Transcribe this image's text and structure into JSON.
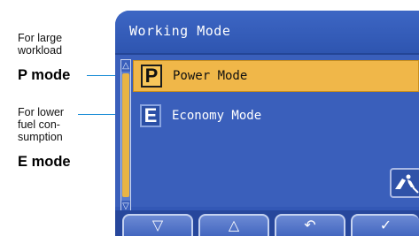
{
  "annotations": {
    "p_desc_line1": "For large",
    "p_desc_line2": "workload",
    "p_mode": "P mode",
    "e_desc_line1": "For lower",
    "e_desc_line2": "fuel con-",
    "e_desc_line3": "sumption",
    "e_mode": "E mode"
  },
  "screen": {
    "title": "Working Mode",
    "items": [
      {
        "letter": "P",
        "label": "Power Mode",
        "selected": true
      },
      {
        "letter": "E",
        "label": "Economy Mode",
        "selected": false
      }
    ],
    "scroll_up_glyph": "△",
    "scroll_down_glyph": "▽"
  },
  "softkeys": [
    {
      "glyph": "▽",
      "icon": "down-arrow-icon"
    },
    {
      "glyph": "△",
      "icon": "up-arrow-icon"
    },
    {
      "glyph": "↶",
      "icon": "return-icon"
    },
    {
      "glyph": "✓",
      "icon": "check-icon"
    }
  ],
  "colors": {
    "screen_blue": "#3358b6",
    "selected_orange": "#f0b749",
    "leader_blue": "#1a8cd6"
  }
}
